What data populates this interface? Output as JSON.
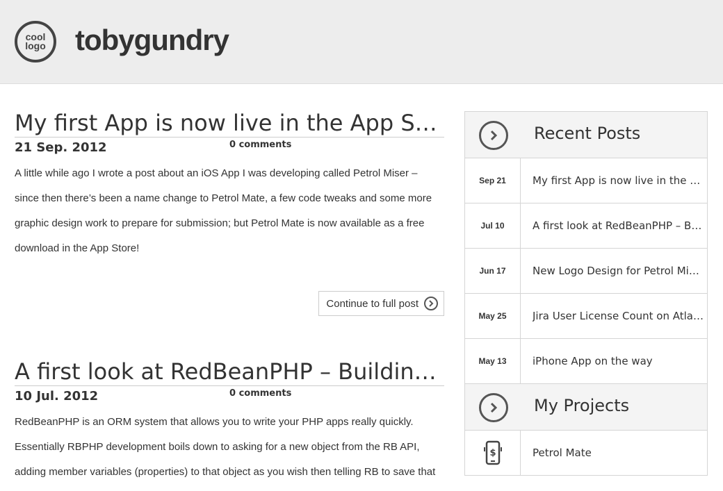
{
  "header": {
    "logo_line1": "cool",
    "logo_line2": "logo",
    "site_title": "tobygundry"
  },
  "posts": [
    {
      "title": "My first App is now live in the App Store!",
      "date": "21 Sep. 2012",
      "comments": "0 comments",
      "body": "A little while ago I wrote a post about an iOS App I was developing called Petrol Miser – since then there’s been a name change to Petrol Mate, a few code tweaks and some more graphic design work to prepare for submission; but Petrol Mate is now available as a free download in the App Store!",
      "continue_label": "Continue to full post"
    },
    {
      "title": "A first look at RedBeanPHP – Building apps quickly",
      "date": "10 Jul. 2012",
      "comments": "0 comments",
      "body": "RedBeanPHP is an ORM system that allows you to write your PHP apps really quickly. Essentially RBPHP development boils down to asking for a new object from the RB API, adding member variables (properties) to that object as you wish then telling RB to save that"
    }
  ],
  "sidebar": {
    "recent_title": "Recent Posts",
    "recent": [
      {
        "date": "Sep 21",
        "title": "My first App is now live in the App Store!"
      },
      {
        "date": "Jul 10",
        "title": "A first look at RedBeanPHP – Building apps quickly"
      },
      {
        "date": "Jun 17",
        "title": "New Logo Design for Petrol Miser"
      },
      {
        "date": "May 25",
        "title": "Jira User License Count on Atlassian OnDemand"
      },
      {
        "date": "May 13",
        "title": "iPhone App on the way"
      }
    ],
    "projects_title": "My Projects",
    "projects": [
      {
        "title": "Petrol Mate",
        "icon": "phone-dollar-icon"
      }
    ]
  },
  "colors": {
    "header_bg": "#ededed",
    "text": "#333333",
    "border": "#d5d5d5"
  }
}
